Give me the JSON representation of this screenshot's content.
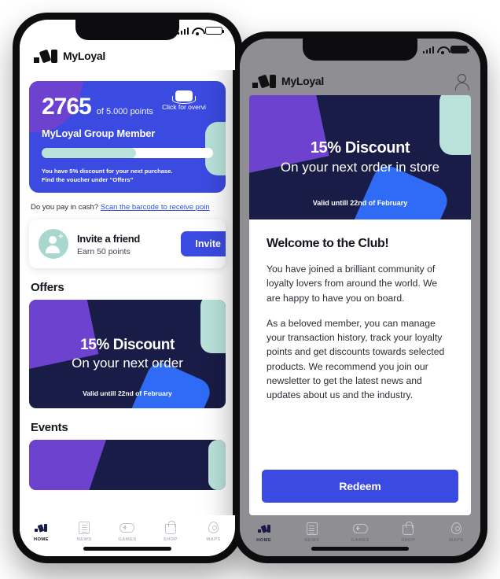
{
  "app": {
    "name": "MyLoyal",
    "logo_icon": "myloyal-logo-icon"
  },
  "colors": {
    "brand_blue": "#3b4ae0",
    "purple": "#6d42cf",
    "mint": "#b9e2da",
    "navy": "#181c46",
    "accent_blue": "#2f6bf5"
  },
  "status_bar": {
    "signal_icon": "cellular-signal-icon",
    "wifi_icon": "wifi-icon",
    "battery_icon": "battery-icon"
  },
  "left_phone": {
    "header": {
      "brand": "MyLoyal"
    },
    "points_card": {
      "points": "2765",
      "of_total": "of 5.000 points",
      "tier": "MyLoyal Group Member",
      "progress_percent": 55,
      "note_line1": "You have 5% discount for your next purchase.",
      "note_line2": "Find the voucher under “Offers”",
      "overview_label": "Click for overvi",
      "overview_icon": "card-overview-icon"
    },
    "cash_row": {
      "question": "Do you pay in cash? ",
      "link": "Scan the barcode to receive poin"
    },
    "invite_card": {
      "avatar_icon": "add-person-icon",
      "title": "Invite a friend",
      "subtitle": "Earn 50 points",
      "button": "Invite"
    },
    "offers_section": {
      "title": "Offers",
      "offer": {
        "headline": "15% Discount",
        "subline": "On your next order",
        "valid": "Valid untill 22nd of February"
      }
    },
    "events_section": {
      "title": "Events"
    },
    "tabbar": [
      {
        "label": "HOME",
        "icon": "home-icon",
        "active": true
      },
      {
        "label": "NEWS",
        "icon": "news-icon",
        "active": false
      },
      {
        "label": "GAMES",
        "icon": "games-icon",
        "active": false
      },
      {
        "label": "SHOP",
        "icon": "shop-icon",
        "active": false
      },
      {
        "label": "MAPS",
        "icon": "maps-icon",
        "active": false
      }
    ]
  },
  "right_phone": {
    "header": {
      "brand": "MyLoyal",
      "profile_icon": "profile-icon"
    },
    "modal": {
      "banner": {
        "headline": "15% Discount",
        "subline": "On your next order in store",
        "valid": "Valid untill 22nd of February"
      },
      "title": "Welcome to the Club!",
      "paragraph1": "You have joined a brilliant community of loyalty lovers from around the world. We are happy to have you on board.",
      "paragraph2": "As a beloved member, you can manage your transaction history, track your loyalty points and get discounts towards selected products. We recommend you join our newsletter to get the latest news and updates about us and the industry.",
      "redeem_button": "Redeem"
    },
    "tabbar": [
      {
        "label": "HOME",
        "icon": "home-icon",
        "active": true
      },
      {
        "label": "NEWS",
        "icon": "news-icon",
        "active": false
      },
      {
        "label": "GAMES",
        "icon": "games-icon",
        "active": false
      },
      {
        "label": "SHOP",
        "icon": "shop-icon",
        "active": false
      },
      {
        "label": "MAPS",
        "icon": "maps-icon",
        "active": false
      }
    ]
  }
}
